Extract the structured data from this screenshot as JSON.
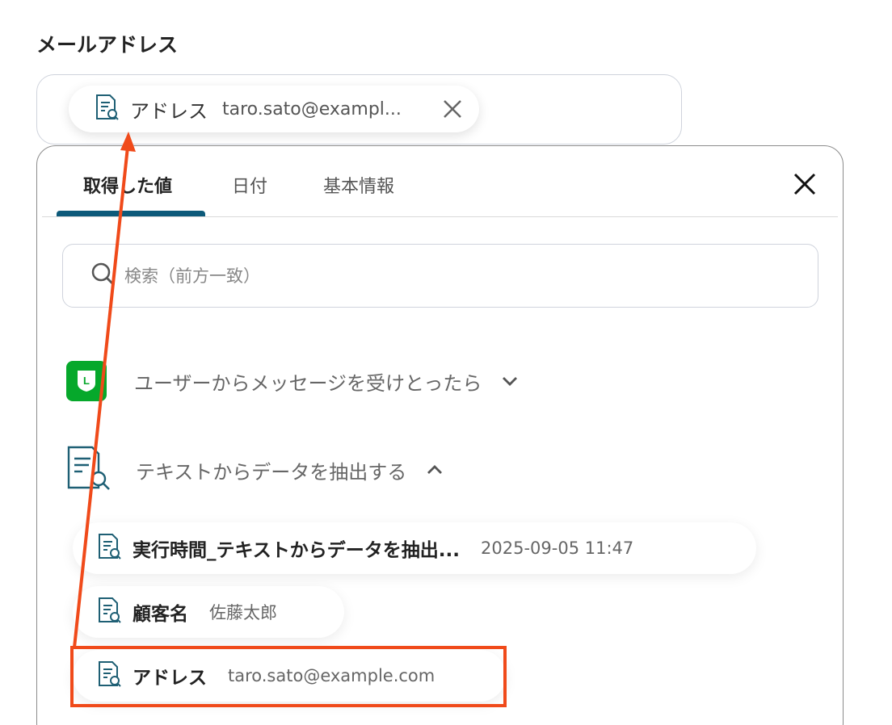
{
  "field": {
    "label": "メールアドレス",
    "chip": {
      "name": "アドレス",
      "value": "taro.sato@exampl..."
    }
  },
  "panel": {
    "tabs": [
      {
        "label": "取得した値",
        "active": true
      },
      {
        "label": "日付",
        "active": false
      },
      {
        "label": "基本情報",
        "active": false
      }
    ],
    "search": {
      "placeholder": "検索（前方一致）",
      "value": ""
    },
    "groups": [
      {
        "title": "ユーザーからメッセージを受けとったら",
        "icon": "line-logo",
        "expanded": false
      },
      {
        "title": "テキストからデータを抽出する",
        "icon": "document-search-icon",
        "expanded": true
      }
    ],
    "items": [
      {
        "name": "実行時間_テキストからデータを抽出...",
        "value": "2025-09-05 11:47"
      },
      {
        "name": "顧客名",
        "value": "佐藤太郎"
      },
      {
        "name": "アドレス",
        "value": "taro.sato@example.com",
        "highlighted": true
      }
    ]
  },
  "colors": {
    "accent": "#0d5a7a",
    "annotation": "#f04a1a",
    "line_green": "#06a82b",
    "icon_teal": "#1e5f74"
  }
}
